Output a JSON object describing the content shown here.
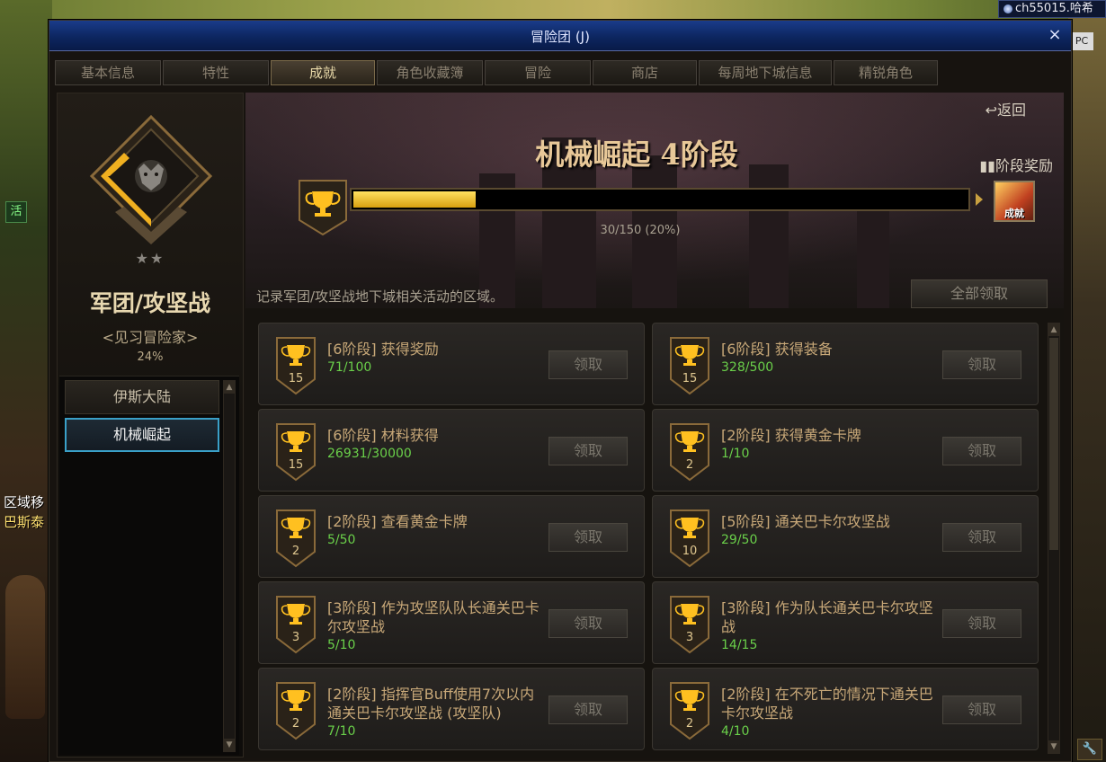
{
  "background": {
    "server_label": "ch55015.哈希",
    "pc_label": "PC",
    "huo_icon": "活",
    "region_text_1": "区域移",
    "region_text_2": "巴斯泰"
  },
  "window": {
    "title": "冒险团 (J)",
    "close_label": "×"
  },
  "tabs": [
    {
      "label": "基本信息",
      "active": false
    },
    {
      "label": "特性",
      "active": false
    },
    {
      "label": "成就",
      "active": true
    },
    {
      "label": "角色收藏簿",
      "active": false
    },
    {
      "label": "冒险",
      "active": false
    },
    {
      "label": "商店",
      "active": false
    },
    {
      "label": "每周地下城信息",
      "active": false
    },
    {
      "label": "精锐角色",
      "active": false
    }
  ],
  "left": {
    "stars": "★★",
    "category": "军团/攻坚战",
    "rank": "<见习冒险家>",
    "percent": "24%",
    "regions": [
      {
        "label": "伊斯大陆",
        "active": false
      },
      {
        "label": "机械崛起",
        "active": true
      }
    ]
  },
  "header": {
    "back_label": "↩返回",
    "stage_title": "机械崛起 4阶段",
    "stage_reward_label": "▮▮阶段奖励",
    "reward_badge": "成就",
    "progress_current": 30,
    "progress_total": 150,
    "progress_text": "30/150 (20%)",
    "description": "记录军团/攻坚战地下城相关活动的区域。",
    "claim_all_label": "全部领取"
  },
  "achievements": [
    {
      "title": "[6阶段] 获得奖励",
      "progress": "71/100",
      "level": "15",
      "claim_label": "领取"
    },
    {
      "title": "[6阶段] 获得装备",
      "progress": "328/500",
      "level": "15",
      "claim_label": "领取"
    },
    {
      "title": "[6阶段] 材料获得",
      "progress": "26931/30000",
      "level": "15",
      "claim_label": "领取"
    },
    {
      "title": "[2阶段] 获得黄金卡牌",
      "progress": "1/10",
      "level": "2",
      "claim_label": "领取"
    },
    {
      "title": "[2阶段] 查看黄金卡牌",
      "progress": "5/50",
      "level": "2",
      "claim_label": "领取"
    },
    {
      "title": "[5阶段] 通关巴卡尔攻坚战",
      "progress": "29/50",
      "level": "10",
      "claim_label": "领取"
    },
    {
      "title": "[3阶段] 作为攻坚队队长通关巴卡尔攻坚战",
      "progress": "5/10",
      "level": "3",
      "claim_label": "领取"
    },
    {
      "title": "[3阶段] 作为队长通关巴卡尔攻坚战",
      "progress": "14/15",
      "level": "3",
      "claim_label": "领取"
    },
    {
      "title": "[2阶段] 指挥官Buff使用7次以内通关巴卡尔攻坚战 (攻坚队)",
      "progress": "7/10",
      "level": "2",
      "claim_label": "领取"
    },
    {
      "title": "[2阶段] 在不死亡的情况下通关巴卡尔攻坚战",
      "progress": "4/10",
      "level": "2",
      "claim_label": "领取"
    }
  ],
  "colors": {
    "gold": "#ffd040",
    "progress_green": "#6ad04a",
    "title_bar": "#0d2660"
  }
}
